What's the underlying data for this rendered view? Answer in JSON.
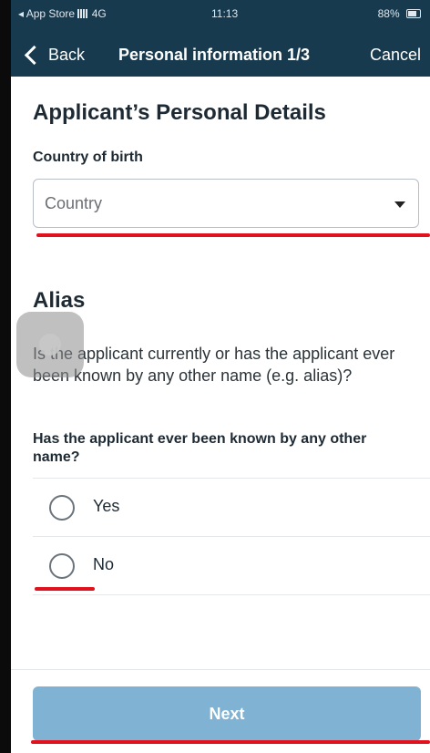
{
  "status_bar": {
    "carrier": "◂ App Store",
    "network": "4G",
    "time": "11:13",
    "battery": "88%"
  },
  "nav": {
    "back_label": "Back",
    "title": "Personal information 1/3",
    "cancel_label": "Cancel"
  },
  "personal_details": {
    "heading": "Applicant’s Personal Details",
    "country_label": "Country of birth",
    "country_placeholder": "Country"
  },
  "alias": {
    "heading": "Alias",
    "question": "Is the applicant currently or has the applicant ever been known by any other name (e.g. alias)?",
    "radio_group_label": "Has the applicant ever been known by any other name?",
    "options": [
      {
        "label": "Yes",
        "selected": false
      },
      {
        "label": "No",
        "selected": false
      }
    ]
  },
  "footer": {
    "next_label": "Next"
  },
  "colors": {
    "header_bg": "#173a4e",
    "next_button_bg": "#7fb2d3",
    "annotation_red": "#e0121e"
  }
}
